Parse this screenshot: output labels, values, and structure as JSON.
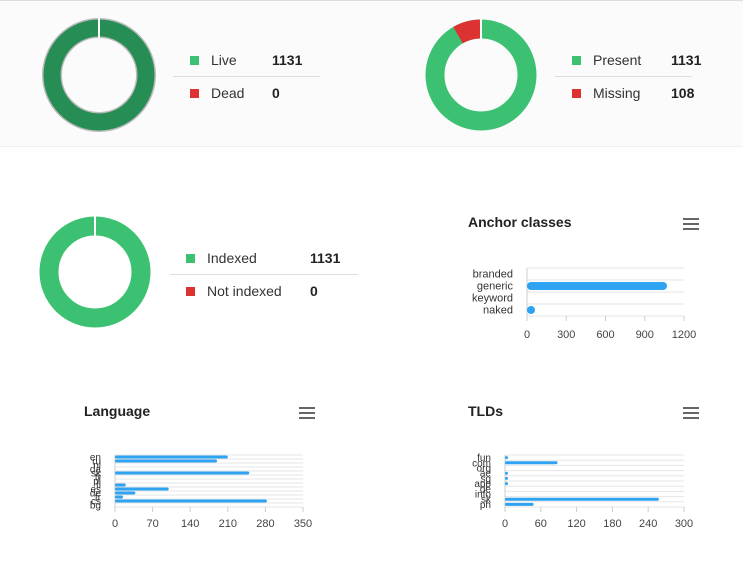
{
  "status_donut": {
    "legend": [
      {
        "label": "Live",
        "value": "1131",
        "color": "#3cc173"
      },
      {
        "label": "Dead",
        "value": "0",
        "color": "#dc3232"
      }
    ],
    "ring_color": "#268e54"
  },
  "presence_donut": {
    "legend": [
      {
        "label": "Present",
        "value": "1131",
        "color": "#3cc173"
      },
      {
        "label": "Missing",
        "value": "108",
        "color": "#dc3232"
      }
    ]
  },
  "index_donut": {
    "legend": [
      {
        "label": "Indexed",
        "value": "1131",
        "color": "#3cc173"
      },
      {
        "label": "Not indexed",
        "value": "0",
        "color": "#dc3232"
      }
    ]
  },
  "chart_data": [
    {
      "type": "bar",
      "orientation": "horizontal",
      "title": "Anchor classes",
      "categories": [
        "branded",
        "generic",
        "keyword",
        "naked"
      ],
      "values": [
        0,
        1070,
        0,
        25
      ],
      "xlim": [
        0,
        1200
      ],
      "ticks": [
        "0",
        "300",
        "600",
        "900",
        "1200"
      ],
      "color": "#2ea3f2",
      "grid": true
    },
    {
      "type": "bar",
      "orientation": "horizontal",
      "title": "Language",
      "categories": [
        "en",
        "ru",
        "nl",
        "da",
        "sk",
        "tr",
        "pl",
        "fi",
        "es",
        "de",
        "fr",
        "cs",
        "bg"
      ],
      "values": [
        210,
        190,
        0,
        0,
        250,
        0,
        0,
        20,
        100,
        38,
        15,
        283,
        0
      ],
      "xlim": [
        0,
        350
      ],
      "ticks": [
        "0",
        "70",
        "140",
        "210",
        "280",
        "350"
      ],
      "color": "#2ea3f2",
      "grid": true
    },
    {
      "type": "bar",
      "orientation": "horizontal",
      "title": "TLDs",
      "categories": [
        "fun",
        "com",
        "org",
        "ae",
        "sg",
        "app",
        "de",
        "info",
        "sk",
        "ph"
      ],
      "values": [
        1,
        88,
        0,
        1,
        5,
        1,
        0,
        0,
        258,
        48
      ],
      "xlim": [
        0,
        300
      ],
      "ticks": [
        "0",
        "60",
        "120",
        "180",
        "240",
        "300"
      ],
      "color": "#2ea3f2",
      "grid": true
    }
  ]
}
